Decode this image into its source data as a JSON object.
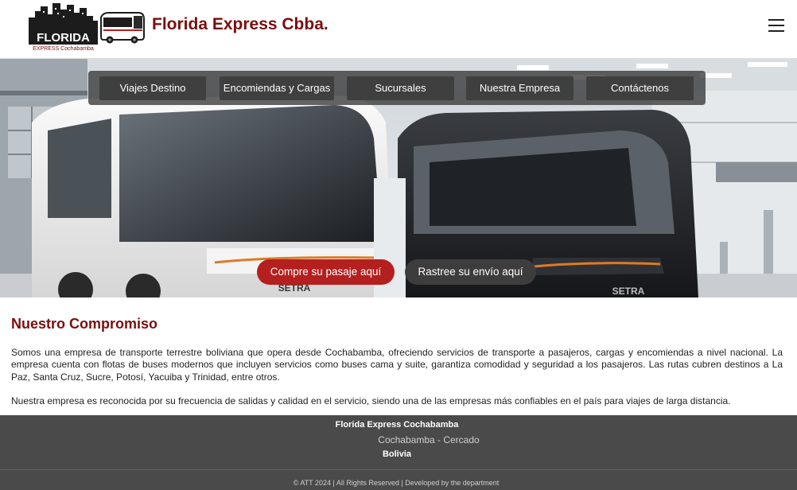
{
  "header": {
    "logo_text": "FLORIDA",
    "logo_subtext": "EXPRESS Cochabamba",
    "title": "Florida Express Cbba."
  },
  "nav": {
    "items": [
      {
        "label": "Viajes Destino"
      },
      {
        "label": "Encomiendas y Cargas"
      },
      {
        "label": "Sucursales"
      },
      {
        "label": "Nuestra Empresa"
      },
      {
        "label": "Contáctenos"
      }
    ]
  },
  "hero": {
    "bus_badge": "SETRA",
    "buy_ticket_label": "Compre su pasaje aquí",
    "track_shipment_label": "Rastree su envío aquí"
  },
  "content": {
    "title": "Nuestro Compromiso",
    "paragraph_1": "Somos una empresa de transporte terrestre boliviana que opera desde Cochabamba, ofreciendo servicios de transporte a pasajeros, cargas y encomiendas a nivel nacional. La empresa cuenta con flotas de buses modernos que incluyen servicios como buses cama y suite, garantiza comodidad y seguridad a los pasajeros. Las rutas cubren destinos a La Paz, Santa Cruz, Sucre, Potosí, Yacuiba y Trinidad, entre otros.",
    "paragraph_2": "Nuestra empresa es reconocida por su frecuencia de salidas y calidad en el servicio, siendo una de las empresas más confiables en el país para viajes de larga distancia."
  },
  "footer": {
    "company": "Florida Express Cochabamba",
    "location": "Cochabamba - Cercado",
    "country": "Bolivia",
    "copyright": "© ATT 2024 | All Rights Reserved | Developed by the department"
  },
  "colors": {
    "brand": "#7b0e0e",
    "cta_red": "#b3201f",
    "cta_dark": "#3d3d3d",
    "footer_bg": "#4a4a4a"
  },
  "icons": {
    "menu": "hamburger-icon"
  }
}
